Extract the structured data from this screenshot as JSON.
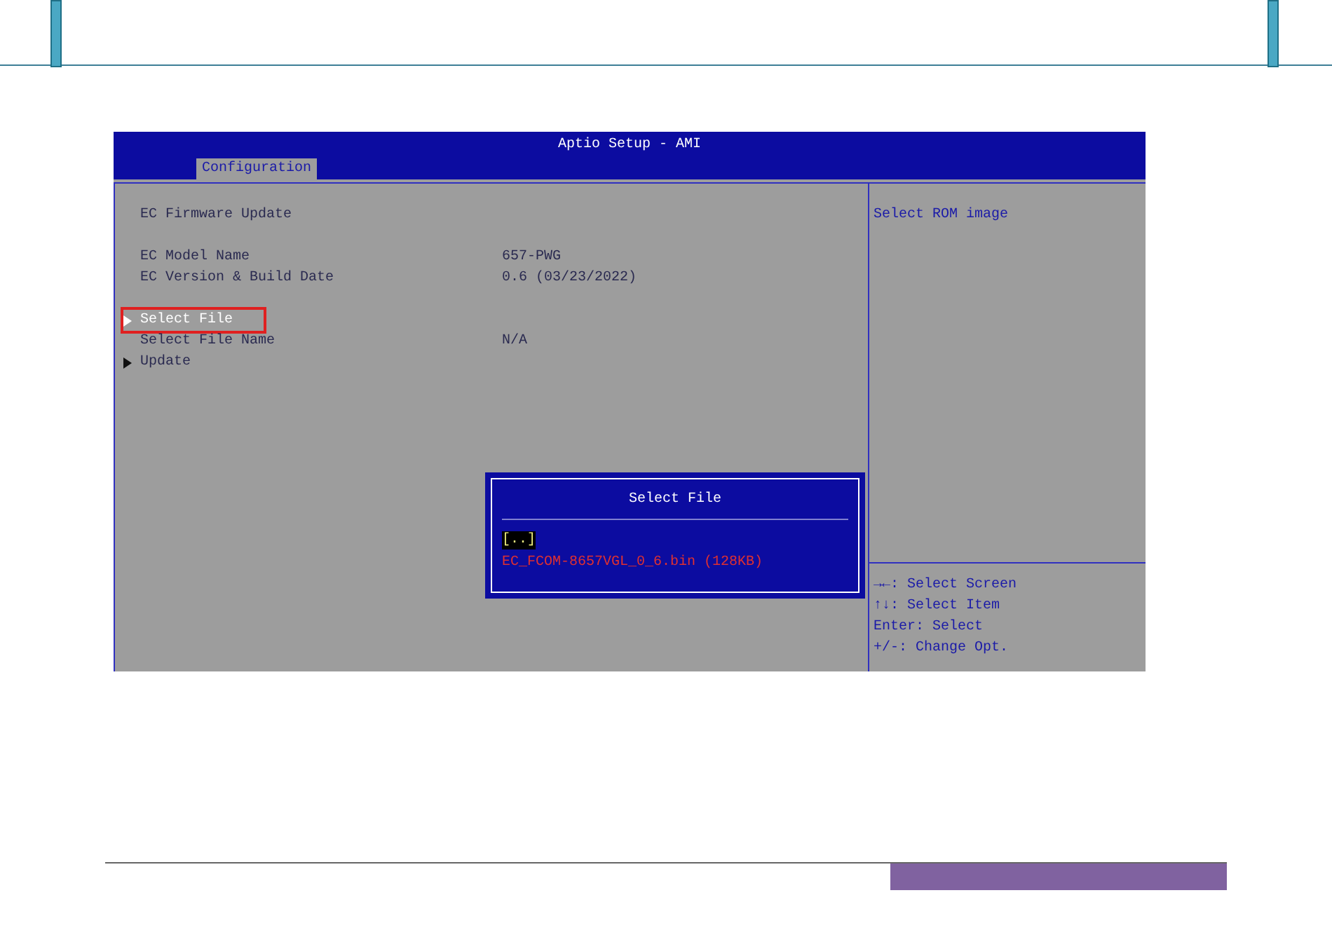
{
  "bios": {
    "title": "Aptio Setup - AMI",
    "tabs": [
      {
        "label": "Configuration",
        "selected": true
      }
    ],
    "items": [
      {
        "kind": "text",
        "label": "EC Firmware Update",
        "selected": false,
        "annotated": false,
        "gap_before": false
      },
      {
        "kind": "info",
        "label": "EC Model Name",
        "value": "657-PWG",
        "selected": false,
        "annotated": false,
        "gap_before": true
      },
      {
        "kind": "info",
        "label": "EC Version & Build Date",
        "value": "0.6 (03/23/2022)",
        "selected": false,
        "annotated": false,
        "gap_before": false
      },
      {
        "kind": "submenu",
        "label": "Select File",
        "selected": true,
        "annotated": true,
        "gap_before": true
      },
      {
        "kind": "info",
        "label": "Select File Name",
        "value": "N/A",
        "selected": false,
        "annotated": false,
        "gap_before": false
      },
      {
        "kind": "submenu",
        "label": "Update",
        "selected": false,
        "annotated": false,
        "gap_before": false
      }
    ],
    "help": "Select ROM image",
    "keys": [
      "→←: Select Screen",
      "↑↓: Select Item",
      "Enter: Select",
      "+/-: Change Opt."
    ],
    "popup": {
      "title": "Select File",
      "options": [
        {
          "label": "[..]",
          "selected": true
        },
        {
          "label": "EC_FCOM-8657VGL_0_6.bin (128KB)",
          "selected": false
        }
      ]
    }
  }
}
